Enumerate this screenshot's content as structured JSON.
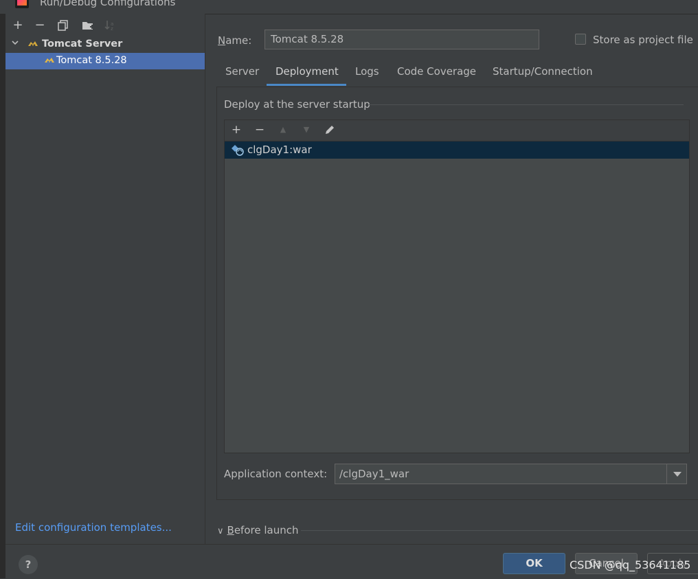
{
  "window": {
    "title": "Run/Debug Configurations"
  },
  "left_toolbar": {
    "add": "+",
    "remove": "−",
    "copy": "⧉",
    "folder": "▆",
    "sort": "↓a"
  },
  "tree": {
    "root_label": "Tomcat Server",
    "child_label": "Tomcat 8.5.28"
  },
  "edit_templates_link": "Edit configuration templates...",
  "name_field": {
    "label_first": "N",
    "label_rest": "ame:",
    "value": "Tomcat 8.5.28"
  },
  "store_as_project_file": {
    "label": "Store as project file",
    "checked": false
  },
  "tabs": [
    "Server",
    "Deployment",
    "Logs",
    "Code Coverage",
    "Startup/Connection"
  ],
  "active_tab": "Deployment",
  "deploy": {
    "section_title": "Deploy at the server startup",
    "toolbar": {
      "add": "+",
      "remove": "−",
      "up": "▲",
      "down": "▼",
      "edit": "✎"
    },
    "items": [
      "clgDay1:war"
    ]
  },
  "app_context": {
    "label": "Application context:",
    "value": "/clgDay1_war"
  },
  "before_launch": {
    "arrow": "∨",
    "first": "B",
    "rest": "efore launch"
  },
  "buttons": {
    "help": "?",
    "ok": "OK",
    "cancel": "Cancel",
    "apply": "Apply"
  },
  "watermark": "CSDN @qq_53641185",
  "colors": {
    "selection": "#4b6eaf",
    "accent": "#4a88c7",
    "link": "#589df6",
    "ok_button": "#365880"
  }
}
